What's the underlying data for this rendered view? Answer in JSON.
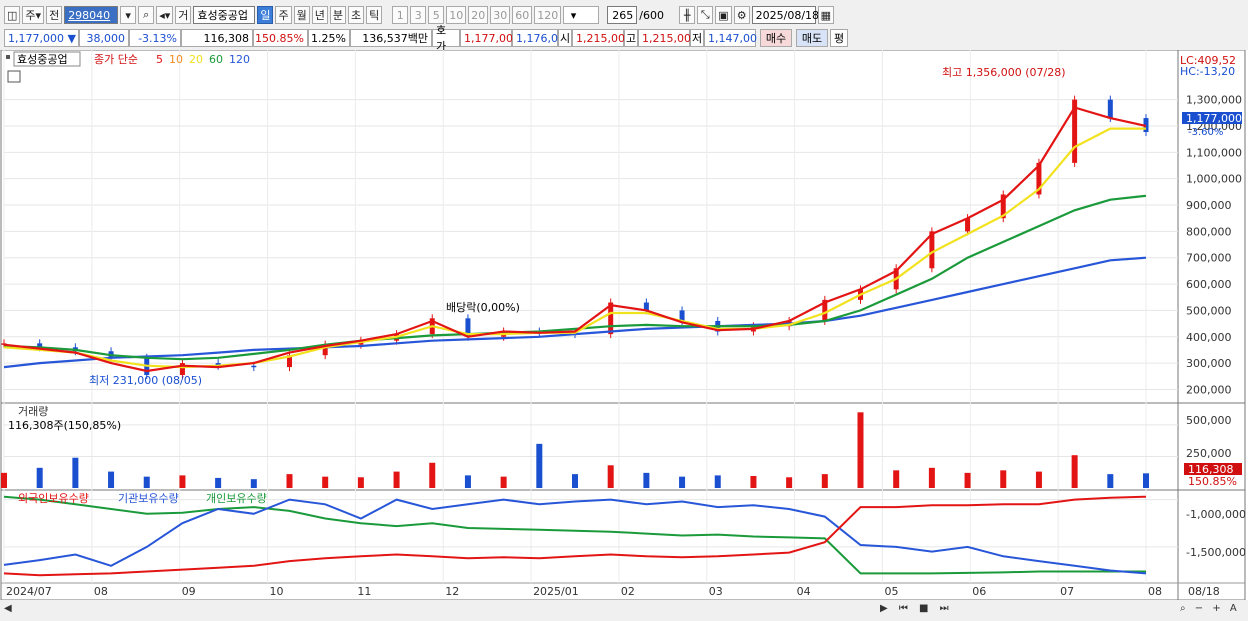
{
  "toolbar": {
    "mode": "주",
    "all": "전",
    "code": "298040",
    "stock_name": "효성중공업",
    "exchange_label": "거",
    "period_tabs": [
      "일",
      "주",
      "월",
      "년",
      "분",
      "초",
      "틱"
    ],
    "selected_period": "일",
    "intervals": [
      "1",
      "3",
      "5",
      "10",
      "20",
      "30",
      "60",
      "120"
    ],
    "count": "265",
    "count_total": "/600",
    "date": "2025/08/18"
  },
  "infobar": {
    "price": "1,177,000",
    "change": "38,000",
    "change_pct": "-3.13%",
    "volume": "116,308",
    "volume_ratio": "150.85%",
    "turnover": "1.25%",
    "amount": "136,537백만",
    "bid_label": "호가",
    "bid": "1,177,00",
    "bid2": "1,176,0",
    "open_label": "시",
    "open": "1,215,00",
    "high_label": "고",
    "high": "1,215,00",
    "low_label": "저",
    "low": "1,147,00",
    "buy": "매수",
    "sell": "매도",
    "eval": "평"
  },
  "legend": {
    "name": "효성중공업",
    "series": "종가 단순",
    "ma": [
      {
        "label": "5",
        "color": "#e31414"
      },
      {
        "label": "10",
        "color": "#f08c1e"
      },
      {
        "label": "20",
        "color": "#f2e21e"
      },
      {
        "label": "60",
        "color": "#1a9a3a"
      },
      {
        "label": "120",
        "color": "#2856d8"
      }
    ]
  },
  "annotations": {
    "high": "최고 1,356,000 (07/28)",
    "low": "최저 231,000 (08/05)",
    "dividend": "배당락(0,00%)",
    "lc": "LC:409,52",
    "hc": "HC:-13,20",
    "last_price": "1,177,000",
    "last_pct": "-3.60%",
    "vol_last": "116,308",
    "vol_pct": "150.85%"
  },
  "volume_panel": {
    "title": "거래량",
    "readout": "116,308주(150,85%)",
    "ticks": [
      "500,000",
      "250,000"
    ]
  },
  "holdings_panel": {
    "legends": [
      {
        "label": "외국인보유수량",
        "color": "#e31414"
      },
      {
        "label": "기관보유수량",
        "color": "#2856d8"
      },
      {
        "label": "개인보유수량",
        "color": "#1a9a3a"
      }
    ],
    "ticks": [
      "-1,000,000",
      "-1,500,000"
    ]
  },
  "chart_data": {
    "type": "line",
    "title": "효성중공업",
    "price_ticks": [
      200000,
      300000,
      400000,
      500000,
      600000,
      700000,
      800000,
      900000,
      1000000,
      1100000,
      1200000,
      1300000
    ],
    "price_tick_labels": [
      "200,000",
      "300,000",
      "400,000",
      "500,000",
      "600,000",
      "700,000",
      "800,000",
      "900,000",
      "1,000,000",
      "1,100,000",
      "1,200,000",
      "1,300,000"
    ],
    "ylim": [
      160000,
      1420000
    ],
    "x_labels": [
      "2024/07",
      "08",
      "09",
      "10",
      "11",
      "12",
      "2025/01",
      "02",
      "03",
      "04",
      "05",
      "06",
      "07",
      "08",
      "08/18"
    ],
    "close": [
      375000,
      360000,
      345000,
      320000,
      255000,
      300000,
      290000,
      285000,
      330000,
      370000,
      385000,
      410000,
      470000,
      400000,
      420000,
      415000,
      410000,
      530000,
      500000,
      460000,
      420000,
      440000,
      460000,
      540000,
      580000,
      660000,
      800000,
      850000,
      940000,
      1060000,
      1300000,
      1230000,
      1177000
    ],
    "ma5": [
      370000,
      355000,
      340000,
      300000,
      270000,
      290000,
      285000,
      300000,
      340000,
      365000,
      385000,
      410000,
      460000,
      400000,
      420000,
      415000,
      420000,
      520000,
      500000,
      455000,
      425000,
      430000,
      460000,
      530000,
      580000,
      650000,
      790000,
      850000,
      920000,
      1050000,
      1270000,
      1230000,
      1200000
    ],
    "ma20": [
      360000,
      350000,
      340000,
      310000,
      290000,
      285000,
      290000,
      300000,
      325000,
      360000,
      380000,
      400000,
      440000,
      410000,
      410000,
      415000,
      415000,
      490000,
      490000,
      460000,
      430000,
      430000,
      445000,
      490000,
      560000,
      620000,
      720000,
      790000,
      860000,
      960000,
      1120000,
      1190000,
      1190000
    ],
    "ma60": [
      365000,
      360000,
      350000,
      330000,
      320000,
      315000,
      320000,
      335000,
      350000,
      370000,
      385000,
      395000,
      405000,
      410000,
      415000,
      420000,
      430000,
      440000,
      445000,
      440000,
      440000,
      440000,
      445000,
      460000,
      500000,
      560000,
      620000,
      700000,
      760000,
      820000,
      880000,
      920000,
      935000
    ],
    "ma120": [
      285000,
      300000,
      310000,
      320000,
      325000,
      330000,
      340000,
      350000,
      355000,
      360000,
      365000,
      375000,
      385000,
      390000,
      395000,
      400000,
      410000,
      420000,
      430000,
      435000,
      440000,
      445000,
      450000,
      460000,
      480000,
      510000,
      540000,
      570000,
      600000,
      630000,
      660000,
      690000,
      700000
    ],
    "volume": [
      120000,
      160000,
      240000,
      130000,
      90000,
      100000,
      80000,
      70000,
      110000,
      90000,
      85000,
      130000,
      200000,
      100000,
      90000,
      350000,
      110000,
      180000,
      120000,
      90000,
      100000,
      95000,
      85000,
      110000,
      600000,
      140000,
      160000,
      120000,
      140000,
      130000,
      260000,
      110000,
      116308
    ],
    "foreign": [
      -1780000,
      -1800000,
      -1790000,
      -1780000,
      -1760000,
      -1740000,
      -1720000,
      -1700000,
      -1650000,
      -1620000,
      -1600000,
      -1580000,
      -1600000,
      -1620000,
      -1610000,
      -1620000,
      -1600000,
      -1580000,
      -1600000,
      -1610000,
      -1600000,
      -1580000,
      -1560000,
      -1450000,
      -1080000,
      -1080000,
      -1060000,
      -1060000,
      -1050000,
      -1050000,
      -1000000,
      -980000,
      -970000
    ],
    "institution": [
      -1690000,
      -1640000,
      -1580000,
      -1700000,
      -1500000,
      -1250000,
      -1100000,
      -1150000,
      -1000000,
      -1050000,
      -1200000,
      -1000000,
      -1100000,
      -1050000,
      -1000000,
      -1050000,
      -1020000,
      -1000000,
      -1050000,
      -1020000,
      -1080000,
      -1060000,
      -1100000,
      -1180000,
      -1480000,
      -1500000,
      -1550000,
      -1500000,
      -1600000,
      -1650000,
      -1700000,
      -1750000,
      -1780000
    ],
    "individual": [
      -970000,
      -1000000,
      -1050000,
      -1100000,
      -1150000,
      -1140000,
      -1100000,
      -1080000,
      -1120000,
      -1200000,
      -1250000,
      -1280000,
      -1250000,
      -1300000,
      -1310000,
      -1320000,
      -1330000,
      -1340000,
      -1360000,
      -1380000,
      -1370000,
      -1390000,
      -1400000,
      -1410000,
      -1780000,
      -1780000,
      -1780000,
      -1775000,
      -1770000,
      -1760000,
      -1760000,
      -1760000,
      -1760000
    ]
  }
}
